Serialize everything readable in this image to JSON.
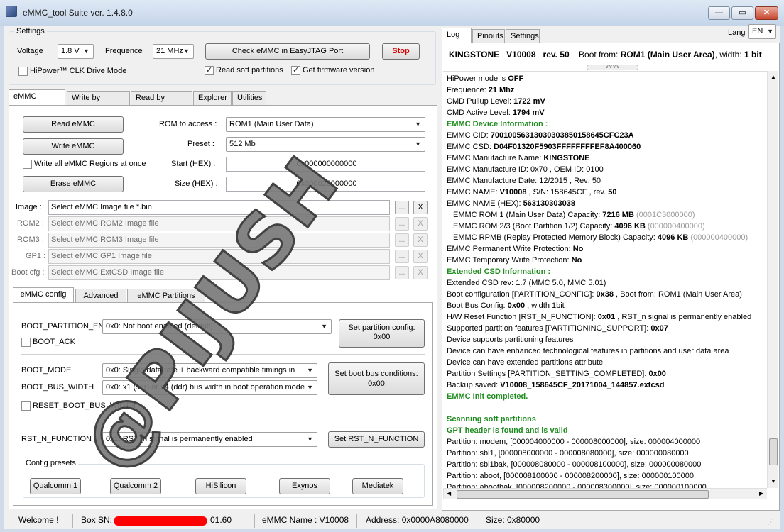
{
  "window": {
    "title": "eMMC_tool Suite  ver. 1.4.8.0",
    "minimize": "—",
    "maximize": "▭",
    "close": "✕"
  },
  "settings": {
    "group_label": "Settings",
    "voltage_label": "Voltage",
    "voltage_value": "1.8 V",
    "frequence_label": "Frequence",
    "frequence_value": "21 MHz",
    "check_button": "Check eMMC in EasyJTAG Port",
    "stop_button": "Stop",
    "hipower_label": "HiPower™ CLK Drive Mode",
    "read_soft_label": "Read soft partitions",
    "get_fw_label": "Get firmware version"
  },
  "main_tabs": [
    "eMMC General",
    "Write by vendor",
    "Read by vendor",
    "Explorer",
    "Utilities"
  ],
  "general": {
    "read_button": "Read eMMC",
    "write_button": "Write eMMC",
    "write_all_label": "Write all eMMC Regions at once",
    "erase_button": "Erase eMMC",
    "rom_label": "ROM to access :",
    "rom_value": "ROM1 (Main User Data)",
    "preset_label": "Preset :",
    "preset_value": "512 Mb",
    "start_label": "Start (HEX) :",
    "start_value": "0x000000000000",
    "size_label": "Size (HEX) :",
    "size_value": "0x000020000000"
  },
  "images": [
    {
      "label": "Image :",
      "value": "Select eMMC Image file *.bin",
      "enabled": true
    },
    {
      "label": "ROM2 :",
      "value": "Select eMMC ROM2 Image file",
      "enabled": false
    },
    {
      "label": "ROM3 :",
      "value": "Select eMMC ROM3 Image file",
      "enabled": false
    },
    {
      "label": "GP1 :",
      "value": "Select eMMC GP1 Image file",
      "enabled": false
    },
    {
      "label": "Boot cfg :",
      "value": "Select eMMC ExtCSD Image file",
      "enabled": false
    }
  ],
  "browse_label": "...",
  "clear_label": "X",
  "config_tabs": [
    "eMMC config",
    "Advanced",
    "eMMC Partitions"
  ],
  "config": {
    "boot_partition_label": "BOOT_PARTITION_EN",
    "boot_partition_value": "0x0: Not boot enabled (default)",
    "boot_ack_label": "BOOT_ACK",
    "set_partition_button_line1": "Set partition config:",
    "set_partition_button_line2": "0x00",
    "boot_mode_label": "BOOT_MODE",
    "boot_mode_value": "0x0: Single data rate + backward compatible timings in",
    "boot_width_label": "BOOT_BUS_WIDTH",
    "boot_width_value": "0x0: x1 (sdr) or x4 (ddr) bus width in boot operation mode",
    "set_boot_bus_line1": "Set boot bus conditions:",
    "set_boot_bus_line2": "0x00",
    "reset_width_label": "RESET_BOOT_BUS_WIDTH",
    "rst_label": "RST_N_FUNCTION",
    "rst_value": "0x1: RST_n signal is permanently enabled",
    "set_rst_button": "Set RST_N_FUNCTION",
    "presets_label": "Config presets",
    "presets": [
      "Qualcomm 1",
      "Qualcomm 2",
      "HiSilicon",
      "Exynos",
      "Mediatek"
    ]
  },
  "right_tabs": [
    "Log",
    "Pinouts",
    "Settings"
  ],
  "lang_label": "Lang",
  "lang_value": "EN",
  "device_header": {
    "vendor": "KINGSTONE",
    "model": "V10008",
    "rev": "rev. 50",
    "boot_from_label": "Boot from:",
    "boot_from_value": "ROM1 (Main User Area)",
    "width": ", width:",
    "width_value": "1 bit"
  },
  "log_lines": [
    {
      "type": "kv",
      "label": "HiPower mode is ",
      "value": "OFF"
    },
    {
      "type": "kv",
      "label": "Frequence: ",
      "value": "21 Mhz"
    },
    {
      "type": "kv",
      "label": "CMD Pullup Level: ",
      "value": "1722  mV"
    },
    {
      "type": "kv",
      "label": "CMD Active Level: ",
      "value": "1794  mV"
    },
    {
      "type": "green",
      "text": "EMMC Device Information :"
    },
    {
      "type": "kv",
      "label": "EMMC CID: ",
      "value": "70010056313030303850158645CFC23A"
    },
    {
      "type": "kv",
      "label": "EMMC CSD: ",
      "value": "D04F01320F5903FFFFFFFFEF8A400060"
    },
    {
      "type": "kv",
      "label": "EMMC Manufacture Name: ",
      "value": "KINGSTONE"
    },
    {
      "type": "plain",
      "text": "EMMC Manufacture ID: 0x70 , OEM ID: 0100"
    },
    {
      "type": "plain",
      "text": "EMMC Manufacture Date: 12/2015 , Rev: 50"
    },
    {
      "type": "name",
      "label": "EMMC NAME: ",
      "value": "V10008",
      "mid": " , S/N: 158645CF , rev. ",
      "value2": "50"
    },
    {
      "type": "kv",
      "label": "EMMC NAME (HEX): ",
      "value": "563130303038"
    },
    {
      "type": "cap",
      "label": "EMMC ROM 1 (Main User Data) Capacity: ",
      "value": "7216 MB",
      "hex": " (0001C3000000)"
    },
    {
      "type": "cap",
      "label": "EMMC ROM 2/3 (Boot Partition 1/2) Capacity: ",
      "value": "4096 KB",
      "hex": " (000000400000)"
    },
    {
      "type": "cap",
      "label": "EMMC RPMB (Replay Protected Memory Block) Capacity: ",
      "value": "4096 KB",
      "hex": " (000000400000)"
    },
    {
      "type": "kv",
      "label": "EMMC Permanent Write Protection: ",
      "value": "No"
    },
    {
      "type": "kv",
      "label": "EMMC Temporary Write Protection: ",
      "value": "No"
    },
    {
      "type": "green",
      "text": "Extended CSD Information :"
    },
    {
      "type": "plain",
      "text": "Extended CSD rev: 1.7 (MMC 5.0, MMC 5.01)"
    },
    {
      "type": "kvs",
      "label": "Boot configuration [PARTITION_CONFIG]: ",
      "value": "0x38",
      "suffix": " , Boot from: ROM1 (Main User Area)"
    },
    {
      "type": "kvs",
      "label": "Boot Bus Config: ",
      "value": "0x00",
      "suffix": " , width 1bit"
    },
    {
      "type": "kvs",
      "label": "H/W Reset Function [RST_N_FUNCTION]: ",
      "value": "0x01",
      "suffix": " , RST_n signal is permanently enabled"
    },
    {
      "type": "kv",
      "label": "Supported partition features [PARTITIONING_SUPPORT]: ",
      "value": "0x07"
    },
    {
      "type": "plain",
      "text": "Device supports partitioning features"
    },
    {
      "type": "plain",
      "text": "Device can have enhanced technological features in partitions and user data area"
    },
    {
      "type": "plain",
      "text": "Device can have extended partitions attribute"
    },
    {
      "type": "kv",
      "label": "Partition Settings [PARTITION_SETTING_COMPLETED]: ",
      "value": "0x00"
    },
    {
      "type": "kv",
      "label": "Backup saved: ",
      "value": "V10008_158645CF_20171004_144857.extcsd"
    },
    {
      "type": "green",
      "text": "EMMC Init completed."
    },
    {
      "type": "blank",
      "text": ""
    },
    {
      "type": "green",
      "text": "Scanning soft partitions"
    },
    {
      "type": "green",
      "text": "GPT header is found and is valid"
    },
    {
      "type": "plain",
      "text": "Partition: modem, [000004000000 - 000008000000], size: 000004000000"
    },
    {
      "type": "plain",
      "text": "Partition: sbl1, [000008000000 - 000008080000], size: 000000080000"
    },
    {
      "type": "plain",
      "text": "Partition: sbl1bak, [000008080000 - 000008100000], size: 000000080000"
    },
    {
      "type": "plain",
      "text": "Partition: aboot, [000008100000 - 000008200000], size: 000000100000"
    },
    {
      "type": "plain",
      "text": "Partition: abootbak, [000008200000 - 000008300000], size: 000000100000"
    }
  ],
  "status": {
    "welcome": "Welcome !",
    "box_sn_label": "Box SN:",
    "box_sn_suffix": "01.60",
    "emmc_name": "eMMC Name : V10008",
    "address": "Address: 0x0000A8080000",
    "size": "Size: 0x80000"
  },
  "watermark": "@PIJUSH",
  "colors": {
    "log_green": "#1e8c1e",
    "stop_text": "#d40000",
    "redaction": "#ff0000"
  }
}
